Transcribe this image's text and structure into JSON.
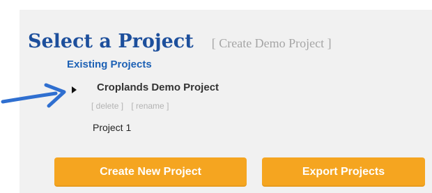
{
  "header": {
    "title": "Select a Project",
    "create_demo_link": "[ Create Demo Project ]"
  },
  "existing": {
    "heading": "Existing Projects",
    "selected_project": {
      "name": "Croplands Demo Project",
      "delete_label": "[ delete ]",
      "rename_label": "[ rename ]"
    },
    "other_projects": [
      "Project 1"
    ]
  },
  "buttons": {
    "create_new": "Create New Project",
    "export": "Export Projects"
  },
  "colors": {
    "title": "#1d4f9c",
    "heading": "#1d61b5",
    "button": "#f5a520",
    "annotation_arrow": "#2f6fd0",
    "panel": "#f1f1f1"
  },
  "icons": {
    "annotation": "arrow-right-icon",
    "expand": "triangle-right-icon"
  }
}
